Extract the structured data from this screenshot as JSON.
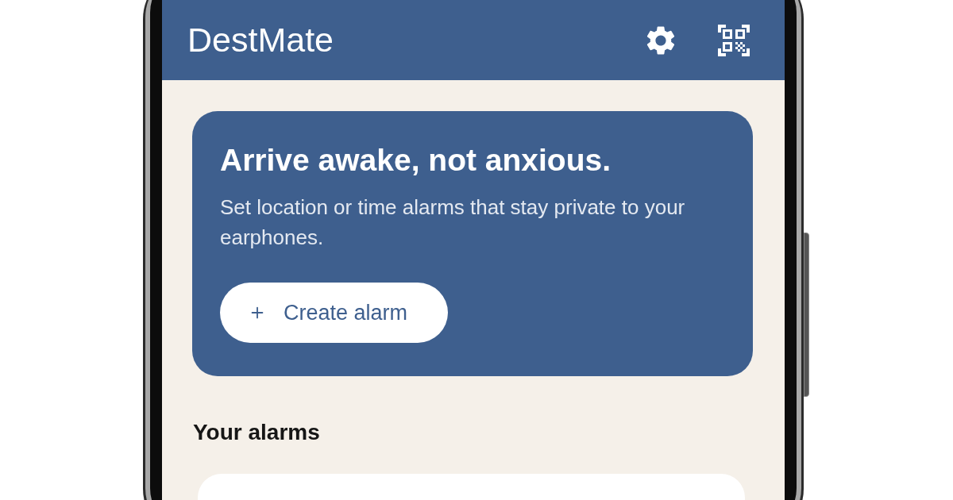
{
  "app_bar": {
    "title": "DestMate"
  },
  "hero": {
    "title": "Arrive awake, not anxious.",
    "subtitle": "Set location or time alarms that stay private to your earphones.",
    "button": {
      "label": "Create alarm"
    }
  },
  "alarms": {
    "heading": "Your alarms"
  }
}
